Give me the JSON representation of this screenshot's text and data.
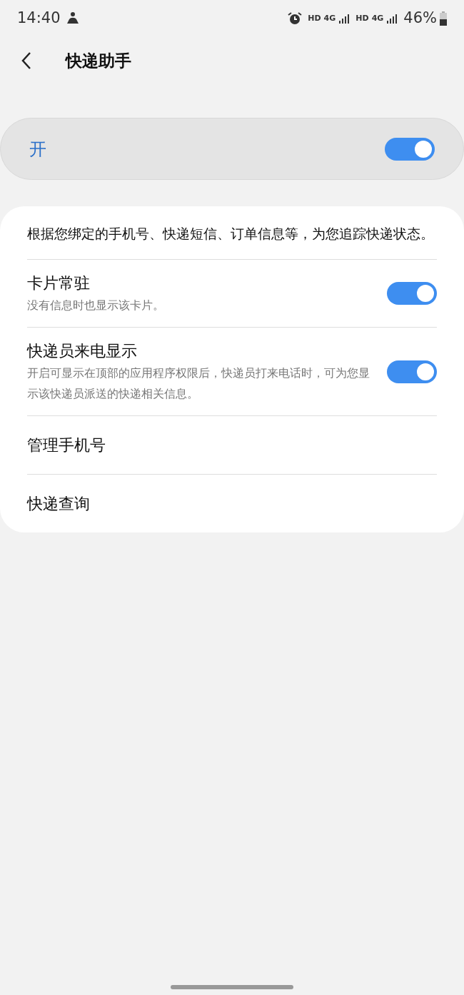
{
  "status_bar": {
    "time": "14:40",
    "labels": [
      "HD",
      "4G",
      "HD",
      "4G"
    ],
    "battery": "46%"
  },
  "header": {
    "title": "快递助手"
  },
  "master_switch": {
    "label": "开",
    "on": true
  },
  "description": "根据您绑定的手机号、快递短信、订单信息等，为您追踪快递状态。",
  "items": [
    {
      "kind": "switch",
      "title": "卡片常驻",
      "subtitle": "没有信息时也显示该卡片。",
      "on": true
    },
    {
      "kind": "switch",
      "title": "快递员来电显示",
      "subtitle": "开启可显示在顶部的应用程序权限后，快递员打来电话时，可为您显示该快递员派送的快递相关信息。",
      "on": true
    },
    {
      "kind": "link",
      "title": "管理手机号"
    },
    {
      "kind": "link",
      "title": "快递查询"
    }
  ]
}
